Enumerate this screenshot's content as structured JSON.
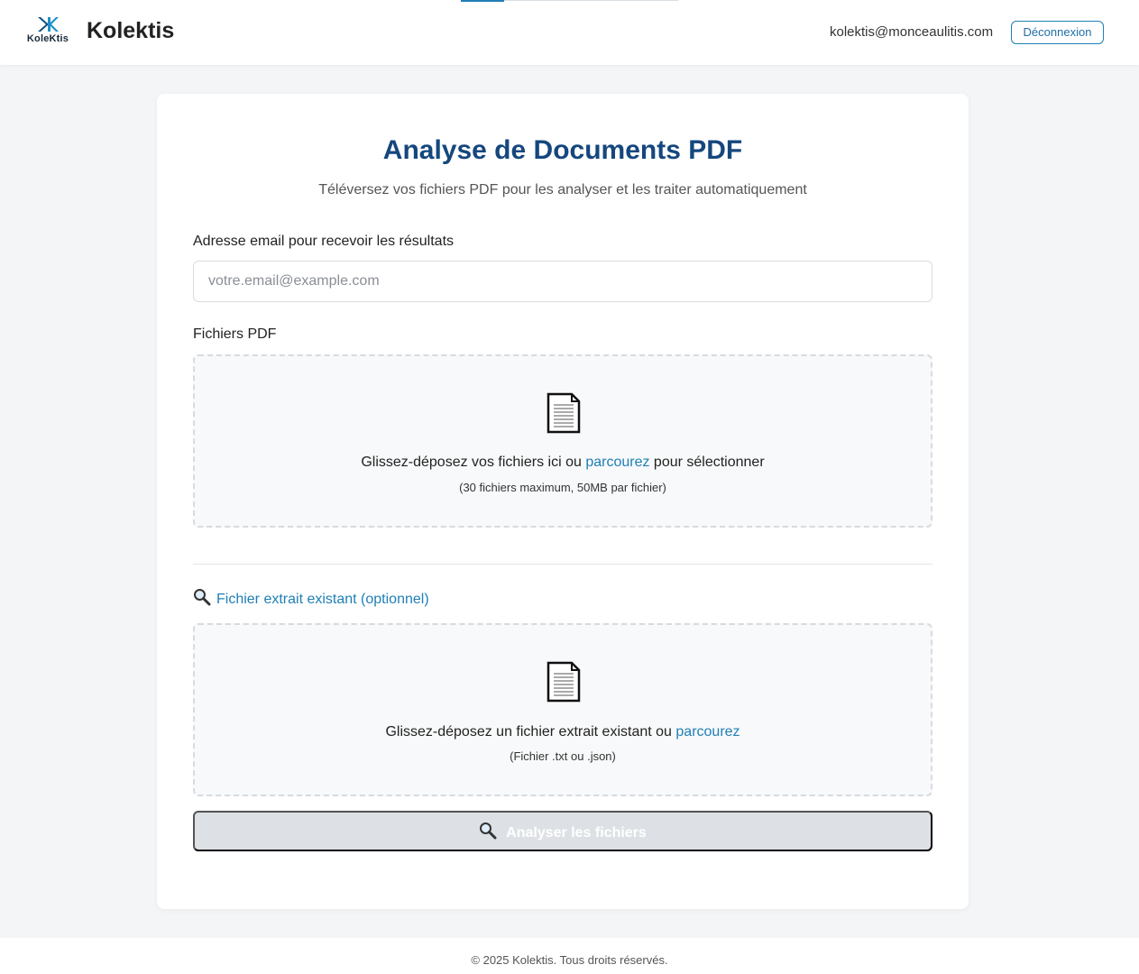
{
  "header": {
    "logo_text": "KoleKtis",
    "app_name": "Kolektis",
    "user_email": "kolektis@monceaulitis.com",
    "logout_label": "Déconnexion"
  },
  "main": {
    "title": "Analyse de Documents PDF",
    "subtitle": "Téléversez vos fichiers PDF pour les analyser et les traiter automatiquement",
    "email_label": "Adresse email pour recevoir les résultats",
    "email_placeholder": "votre.email@example.com",
    "email_value": "",
    "pdf_label": "Fichiers PDF",
    "pdf_dropzone": {
      "text_before": "Glissez-déposez vos fichiers ici ou ",
      "link": "parcourez",
      "text_after": " pour sélectionner",
      "hint": "(30 fichiers maximum, 50MB par fichier)",
      "icon": "document-icon"
    },
    "optional_link": "Fichier extrait existant (optionnel)",
    "optional_icon": "magnifier-icon",
    "extract_dropzone": {
      "text_before": "Glissez-déposez un fichier extrait existant ou ",
      "link": "parcourez",
      "text_after": "",
      "hint": "(Fichier .txt ou .json)",
      "icon": "document-icon"
    },
    "analyze_label": "Analyser les fichiers"
  },
  "footer": {
    "text": "© 2025 Kolektis. Tous droits réservés."
  },
  "colors": {
    "accent": "#1f7fb5",
    "title": "#15477e",
    "button_disabled": "#dde1e5"
  }
}
